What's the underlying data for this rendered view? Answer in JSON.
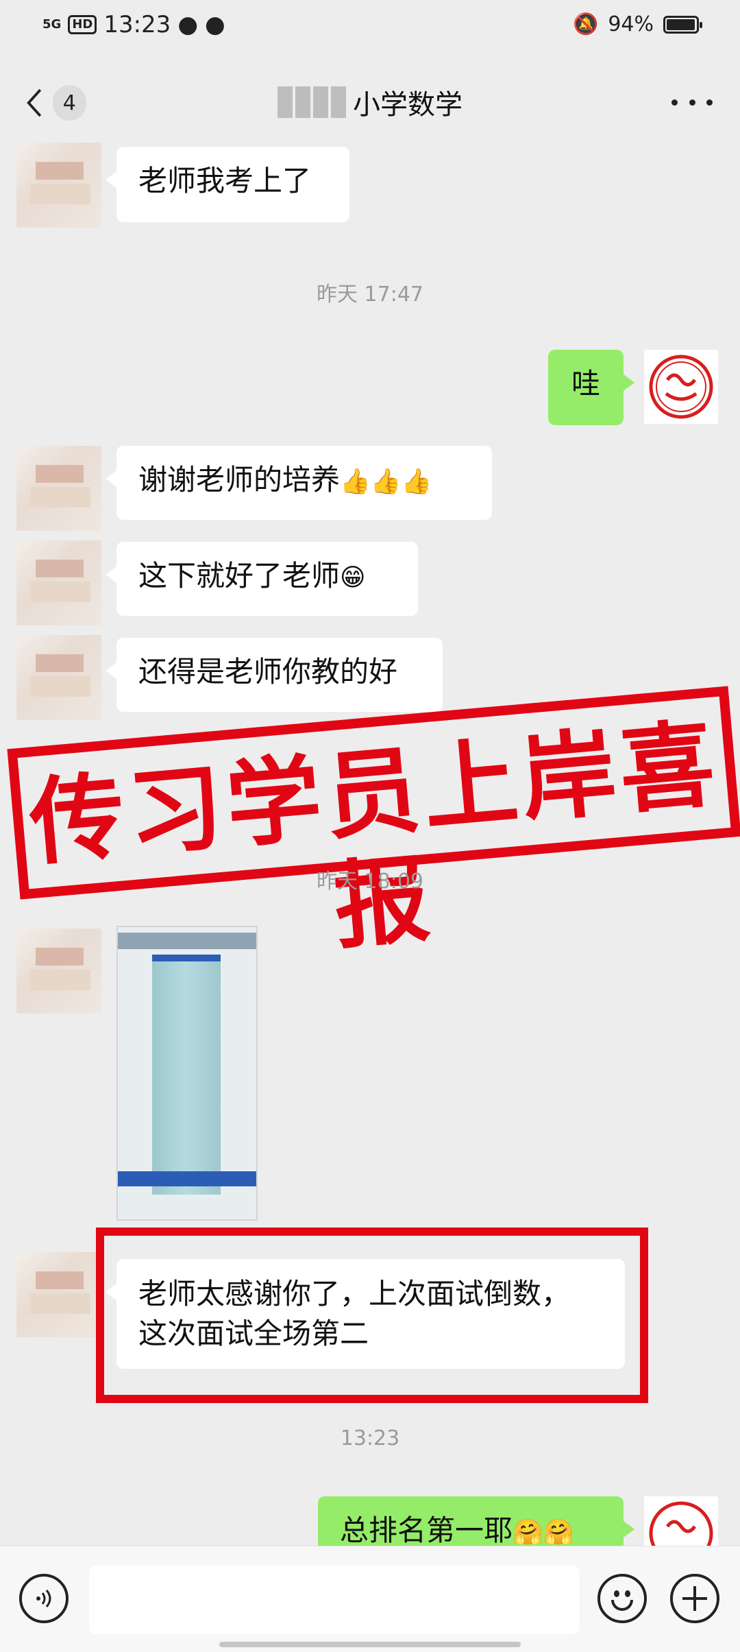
{
  "status_bar": {
    "network": "5G",
    "hd": "HD",
    "time": "13:23",
    "battery": "94%",
    "battery_level": 0.94
  },
  "nav": {
    "back_count": "4",
    "title": "小学数学"
  },
  "messages": {
    "m1": "老师我考上了",
    "t1": "昨天 17:47",
    "m2": "哇",
    "m3": "谢谢老师的培养",
    "m3_emoji": "👍👍👍",
    "m4": "这下就好了老师",
    "m4_emoji": "😁",
    "m5": "还得是老师你教的好",
    "t2": "昨天 18:09",
    "m6_line1": "老师太感谢你了，上次面试倒数，",
    "m6_line2": "这次面试全场第二",
    "t3": "13:23",
    "m7": "总排名第一耶",
    "m7_emoji": "🤗🤗"
  },
  "overlay": {
    "stamp_text": "传习学员上岸喜报"
  },
  "input_bar": {
    "placeholder": ""
  },
  "colors": {
    "sent_bubble": "#95ec69",
    "stamp_red": "#e10613",
    "background": "#ededed"
  },
  "icons": [
    "back-icon",
    "more-icon",
    "voice-icon",
    "emoji-icon",
    "plus-icon",
    "seal-avatar-icon"
  ]
}
